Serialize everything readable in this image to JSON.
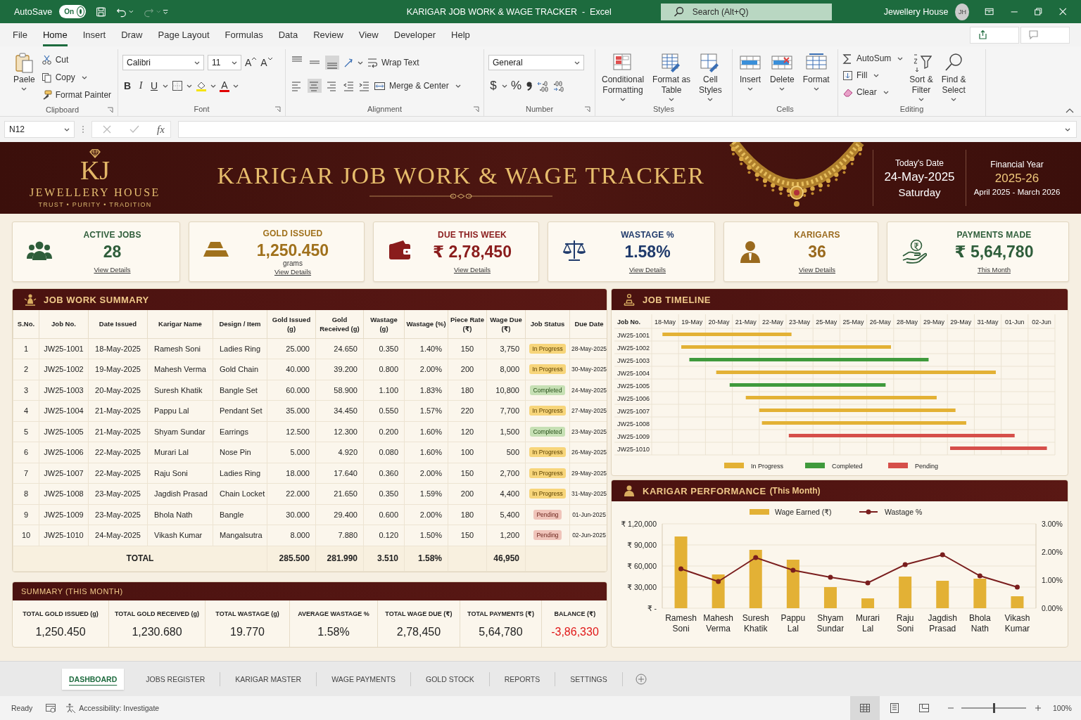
{
  "titlebar": {
    "autosave_label": "AutoSave",
    "autosave_toggle": {
      "label": "On",
      "on": true
    },
    "title": "KARIGAR JOB WORK & WAGE TRACKER  -  Excel",
    "search_placeholder": "Search (Alt+Q)",
    "account_name": "Jewellery House",
    "avatar_initials": "JH"
  },
  "menu_tabs": [
    {
      "label": "File",
      "selected": false
    },
    {
      "label": "Home",
      "selected": true
    },
    {
      "label": "Insert",
      "selected": false
    },
    {
      "label": "Draw",
      "selected": false
    },
    {
      "label": "Page Layout",
      "selected": false
    },
    {
      "label": "Formulas",
      "selected": false
    },
    {
      "label": "Data",
      "selected": false
    },
    {
      "label": "Review",
      "selected": false
    },
    {
      "label": "View",
      "selected": false
    },
    {
      "label": "Developer",
      "selected": false
    },
    {
      "label": "Help",
      "selected": false
    }
  ],
  "ribbon": {
    "clipboard": {
      "label": "Clipboard",
      "paste": "Paele",
      "cut": "Cut",
      "copy": "Copy",
      "format_painter": "Format Painter"
    },
    "font": {
      "label": "Font",
      "font_name": "Calibri",
      "font_size": "11",
      "grow": "A",
      "shrink": "A",
      "style_buttons": [
        "B",
        "I",
        "U"
      ],
      "font_color": "A"
    },
    "alignment": {
      "label": "Alignment",
      "vertical_align": [
        {
          "selected": false
        },
        {
          "selected": false
        },
        {
          "selected": true
        }
      ],
      "horizontal_align": [
        {
          "selected": false
        },
        {
          "selected": true
        },
        {
          "selected": false
        }
      ],
      "wrap_text": "Wrap Text",
      "merge_center": "Merge & Center"
    },
    "number": {
      "label": "Number",
      "format": "General",
      "currency": "$",
      "percent": "%"
    },
    "styles": {
      "label": "Styles",
      "items": [
        "Conditional\nFormatting",
        "Format as\nTable",
        "Cell\nStyles"
      ]
    },
    "cells": {
      "label": "Cells",
      "items": [
        "Insert",
        "Delete",
        "Format"
      ]
    },
    "editing": {
      "label": "Editing",
      "small_items": [
        "AutoSum",
        "Fill",
        "Clear"
      ],
      "large_items": [
        "Sort &\nFilter",
        "Find &\nSelect"
      ]
    }
  },
  "formula_bar": {
    "name_box": "N12",
    "fx": "fx"
  },
  "banner": {
    "logo": "KJ",
    "brand": "JEWELLERY HOUSE",
    "tagline": "TRUST • PURITY • TRADITION",
    "title": "KARIGAR JOB WORK & WAGE TRACKER",
    "date_label": "Today's Date",
    "date": "24-May-2025",
    "weekday": "Saturday",
    "fy_label": "Financial Year",
    "fy": "2025-26",
    "fy_range": "April 2025 - March 2026"
  },
  "kpis": [
    {
      "kind": "people",
      "title": "ACTIVE JOBS",
      "value": "28",
      "link": "View Details",
      "color": "#2e5d3a"
    },
    {
      "kind": "gold",
      "title": "GOLD ISSUED",
      "value": "1,250.450",
      "unit": "grams",
      "link": "View Details",
      "color": "#a0711c"
    },
    {
      "kind": "wallet",
      "title": "DUE THIS WEEK",
      "value": "₹ 2,78,450",
      "link": "View Details",
      "color": "#8a1c1c"
    },
    {
      "kind": "scale",
      "title": "WASTAGE %",
      "value": "1.58%",
      "link": "View Details",
      "color": "#1f3a6b"
    },
    {
      "kind": "person",
      "title": "KARIGARS",
      "value": "36",
      "link": "View Details",
      "color": "#9a6a1e"
    },
    {
      "kind": "money",
      "title": "PAYMENTS MADE",
      "value": "₹ 5,64,780",
      "link": "This Month",
      "color": "#2e5d3a"
    }
  ],
  "job_summary": {
    "header": "JOB WORK SUMMARY",
    "columns": [
      "S.No.",
      "Job No.",
      "Date Issued",
      "Karigar Name",
      "Design / Item",
      "Gold Issued (g)",
      "Gold Received (g)",
      "Wastage (g)",
      "Wastage (%)",
      "Piece Rate (₹)",
      "Wage Due (₹)",
      "Job Status",
      "Due Date"
    ],
    "rows": [
      {
        "cells": [
          "1",
          "JW25-1001",
          "18-May-2025",
          "Ramesh Soni",
          "Ladies Ring",
          "25.000",
          "24.650",
          "0.350",
          "1.40%",
          "150",
          "3,750"
        ],
        "status": "In Progress",
        "kind": "in_progress",
        "due": "28-May-2025"
      },
      {
        "cells": [
          "2",
          "JW25-1002",
          "19-May-2025",
          "Mahesh Verma",
          "Gold Chain",
          "40.000",
          "39.200",
          "0.800",
          "2.00%",
          "200",
          "8,000"
        ],
        "status": "In Progress",
        "kind": "in_progress",
        "due": "30-May-2025"
      },
      {
        "cells": [
          "3",
          "JW25-1003",
          "20-May-2025",
          "Suresh Khatik",
          "Bangle Set",
          "60.000",
          "58.900",
          "1.100",
          "1.83%",
          "180",
          "10,800"
        ],
        "status": "Completed",
        "kind": "completed",
        "due": "24-May-2025"
      },
      {
        "cells": [
          "4",
          "JW25-1004",
          "21-May-2025",
          "Pappu Lal",
          "Pendant Set",
          "35.000",
          "34.450",
          "0.550",
          "1.57%",
          "220",
          "7,700"
        ],
        "status": "In Progress",
        "kind": "in_progress",
        "due": "27-May-2025"
      },
      {
        "cells": [
          "5",
          "JW25-1005",
          "21-May-2025",
          "Shyam Sundar",
          "Earrings",
          "12.500",
          "12.300",
          "0.200",
          "1.60%",
          "120",
          "1,500"
        ],
        "status": "Completed",
        "kind": "completed",
        "due": "23-May-2025"
      },
      {
        "cells": [
          "6",
          "JW25-1006",
          "22-May-2025",
          "Murari Lal",
          "Nose Pin",
          "5.000",
          "4.920",
          "0.080",
          "1.60%",
          "100",
          "500"
        ],
        "status": "In Progress",
        "kind": "in_progress",
        "due": "26-May-2025"
      },
      {
        "cells": [
          "7",
          "JW25-1007",
          "22-May-2025",
          "Raju Soni",
          "Ladies Ring",
          "18.000",
          "17.640",
          "0.360",
          "2.00%",
          "150",
          "2,700"
        ],
        "status": "In Progress",
        "kind": "in_progress",
        "due": "29-May-2025"
      },
      {
        "cells": [
          "8",
          "JW25-1008",
          "23-May-2025",
          "Jagdish Prasad",
          "Chain Locket",
          "22.000",
          "21.650",
          "0.350",
          "1.59%",
          "200",
          "4,400"
        ],
        "status": "In Progress",
        "kind": "in_progress",
        "due": "31-May-2025"
      },
      {
        "cells": [
          "9",
          "JW25-1009",
          "23-May-2025",
          "Bhola Nath",
          "Bangle",
          "30.000",
          "29.400",
          "0.600",
          "2.00%",
          "180",
          "5,400"
        ],
        "status": "Pending",
        "kind": "pending",
        "due": "01-Jun-2025"
      },
      {
        "cells": [
          "10",
          "JW25-1010",
          "24-May-2025",
          "Vikash Kumar",
          "Mangalsutra",
          "8.000",
          "7.880",
          "0.120",
          "1.50%",
          "150",
          "1,200"
        ],
        "status": "Pending",
        "kind": "pending",
        "due": "02-Jun-2025"
      }
    ],
    "total": {
      "label": "TOTAL",
      "gold_issued": "285.500",
      "gold_received": "281.990",
      "wastage_g": "3.510",
      "wastage_pct": "1.58%",
      "wage_due": "46,950"
    }
  },
  "summary": {
    "header": "SUMMARY (THIS MONTH)",
    "items": [
      {
        "label": "TOTAL GOLD ISSUED (g)",
        "value": "1,250.450",
        "negative": false
      },
      {
        "label": "TOTAL GOLD RECEIVED (g)",
        "value": "1,230.680",
        "negative": false
      },
      {
        "label": "TOTAL WASTAGE (g)",
        "value": "19.770",
        "negative": false
      },
      {
        "label": "AVERAGE WASTAGE %",
        "value": "1.58%",
        "negative": false
      },
      {
        "label": "TOTAL WAGE DUE (₹)",
        "value": "2,78,450",
        "negative": false
      },
      {
        "label": "TOTAL PAYMENTS (₹)",
        "value": "5,64,780",
        "negative": false
      },
      {
        "label": "BALANCE (₹)",
        "value": "-3,86,330",
        "negative": true
      }
    ]
  },
  "timeline": {
    "header": "JOB TIMELINE",
    "column_header": "Job No.",
    "dates": [
      "18-May",
      "19-May",
      "20-May",
      "21-May",
      "22-May",
      "23-May",
      "25-May",
      "25-May",
      "26-May",
      "28-May",
      "29-May",
      "29-May",
      "31-May",
      "01-Jun",
      "02-Jun"
    ],
    "rows": [
      {
        "job": "JW25-1001",
        "color": "#e3b135"
      },
      {
        "job": "JW25-1002",
        "color": "#e3b135"
      },
      {
        "job": "JW25-1003",
        "color": "#3f9a3c"
      },
      {
        "job": "JW25-1004",
        "color": "#e3b135"
      },
      {
        "job": "JW25-1005",
        "color": "#3f9a3c"
      },
      {
        "job": "JW25-1006",
        "color": "#e3b135"
      },
      {
        "job": "JW25-1007",
        "color": "#e3b135"
      },
      {
        "job": "JW25-1008",
        "color": "#e3b135"
      },
      {
        "job": "JW25-1009",
        "color": "#d64f4a"
      },
      {
        "job": "JW25-1010",
        "color": "#d64f4a"
      }
    ],
    "legend": [
      {
        "label": "In Progress",
        "color": "#e3b135"
      },
      {
        "label": "Completed",
        "color": "#3f9a3c"
      },
      {
        "label": "Pending",
        "color": "#d64f4a"
      }
    ]
  },
  "performance": {
    "header": "KARIGAR PERFORMANCE",
    "header_note": "(This Month)",
    "chart_data": {
      "type": "bar",
      "grid": true,
      "legend": true,
      "categories": [
        "Ramesh Soni",
        "Mahesh Verma",
        "Suresh Khatik",
        "Pappu Lal",
        "Shyam Sundar",
        "Murari Lal",
        "Raju Soni",
        "Jagdish Prasad",
        "Bhola Nath",
        "Vikash Kumar"
      ],
      "ylim": [
        0,
        120000
      ],
      "yticks": [
        {
          "value": 0,
          "label": "₹ -"
        },
        {
          "value": 30000,
          "label": "₹ 30,000"
        },
        {
          "value": 60000,
          "label": "₹ 60,000"
        },
        {
          "value": 90000,
          "label": "₹ 90,000"
        },
        {
          "value": 120000,
          "label": "₹ 1,20,000"
        }
      ],
      "y2lim": [
        0,
        0.03
      ],
      "y2ticks": [
        {
          "value": 0,
          "label": "0.00%"
        },
        {
          "value": 0.01,
          "label": "1.00%"
        },
        {
          "value": 0.02,
          "label": "2.00%"
        },
        {
          "value": 0.03,
          "label": "3.00%"
        }
      ],
      "series": [
        {
          "name": "Wage Earned (₹)",
          "type": "bar",
          "color": "#e3b135",
          "values": [
            102000,
            48000,
            83000,
            69000,
            30000,
            14000,
            45000,
            39000,
            42000,
            17000
          ]
        },
        {
          "name": "Wastage %",
          "type": "line",
          "axis": "y2",
          "marker": "circle",
          "color": "#7a1e1e",
          "values": [
            0.014,
            0.0095,
            0.018,
            0.0135,
            0.011,
            0.009,
            0.0155,
            0.019,
            0.0115,
            0.0075
          ]
        }
      ]
    }
  },
  "sheet_tabs": [
    {
      "label": "DASHBOARD",
      "selected": true
    },
    {
      "label": "JOBS REGISTER",
      "selected": false
    },
    {
      "label": "KARIGAR MASTER",
      "selected": false
    },
    {
      "label": "WAGE PAYMENTS",
      "selected": false
    },
    {
      "label": "GOLD STOCK",
      "selected": false
    },
    {
      "label": "REPORTS",
      "selected": false
    },
    {
      "label": "SETTINGS",
      "selected": false
    }
  ],
  "status_bar": {
    "ready": "Ready",
    "accessibility": "Accessibility: Investigate",
    "views": [
      {
        "selected": true
      },
      {
        "selected": false
      },
      {
        "selected": false
      }
    ],
    "zoom_slider": {
      "level": 0.5
    },
    "zoom": "100%"
  }
}
